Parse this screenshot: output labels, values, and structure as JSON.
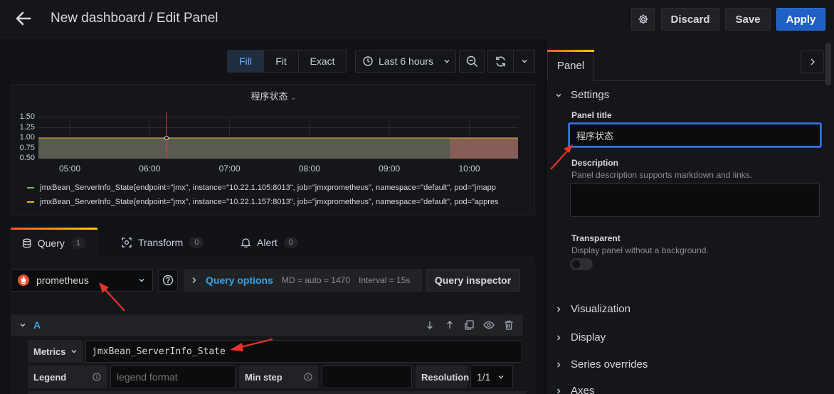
{
  "header": {
    "title": "New dashboard / Edit Panel",
    "discard_label": "Discard",
    "save_label": "Save",
    "apply_label": "Apply"
  },
  "toolbar": {
    "fill_label": "Fill",
    "fit_label": "Fit",
    "exact_label": "Exact",
    "time_range": "Last 6 hours"
  },
  "panel_preview": {
    "title": "程序状态",
    "chart_data": {
      "type": "area",
      "x": [
        "05:00",
        "06:00",
        "07:00",
        "08:00",
        "09:00",
        "10:00"
      ],
      "yticks": [
        "1.50",
        "1.25",
        "1.00",
        "0.75",
        "0.50"
      ],
      "ylim": [
        0.5,
        1.5
      ],
      "series": [
        {
          "name": "jmxBean_ServerInfo_State{endpoint=\"jmx\", instance=\"10.22.1.105:8013\", job=\"jmxprometheus\", namespace=\"default\", pod=\"jmapp",
          "color": "#7eb26d",
          "value": 1
        },
        {
          "name": "jmxBean_ServerInfo_State{endpoint=\"jmx\", instance=\"10.22.1.157:8013\", job=\"jmxprometheus\", namespace=\"default\", pod=\"appres",
          "color": "#eab839",
          "value": 1
        }
      ]
    }
  },
  "query_tabs": [
    {
      "label": "Query",
      "count": "1",
      "icon": "database-icon"
    },
    {
      "label": "Transform",
      "count": "0",
      "icon": "transform-icon"
    },
    {
      "label": "Alert",
      "count": "0",
      "icon": "bell-icon"
    }
  ],
  "query": {
    "datasource": "prometheus",
    "options_label": "Query options",
    "md": "MD = auto = 1470",
    "interval": "Interval = 15s",
    "inspector_label": "Query inspector",
    "ref_id": "A",
    "metrics_label": "Metrics",
    "metrics_value": "jmxBean_ServerInfo_State",
    "legend_label": "Legend",
    "legend_placeholder": "legend format",
    "min_step_label": "Min step",
    "resolution_label": "Resolution",
    "resolution_value": "1/1"
  },
  "options_pane": {
    "tab_label": "Panel",
    "settings_label": "Settings",
    "panel_title_label": "Panel title",
    "panel_title_value": "程序状态",
    "description_label": "Description",
    "description_help": "Panel description supports markdown and links.",
    "transparent_label": "Transparent",
    "transparent_help": "Display panel without a background.",
    "sections": [
      "Visualization",
      "Display",
      "Series overrides",
      "Axes"
    ]
  }
}
